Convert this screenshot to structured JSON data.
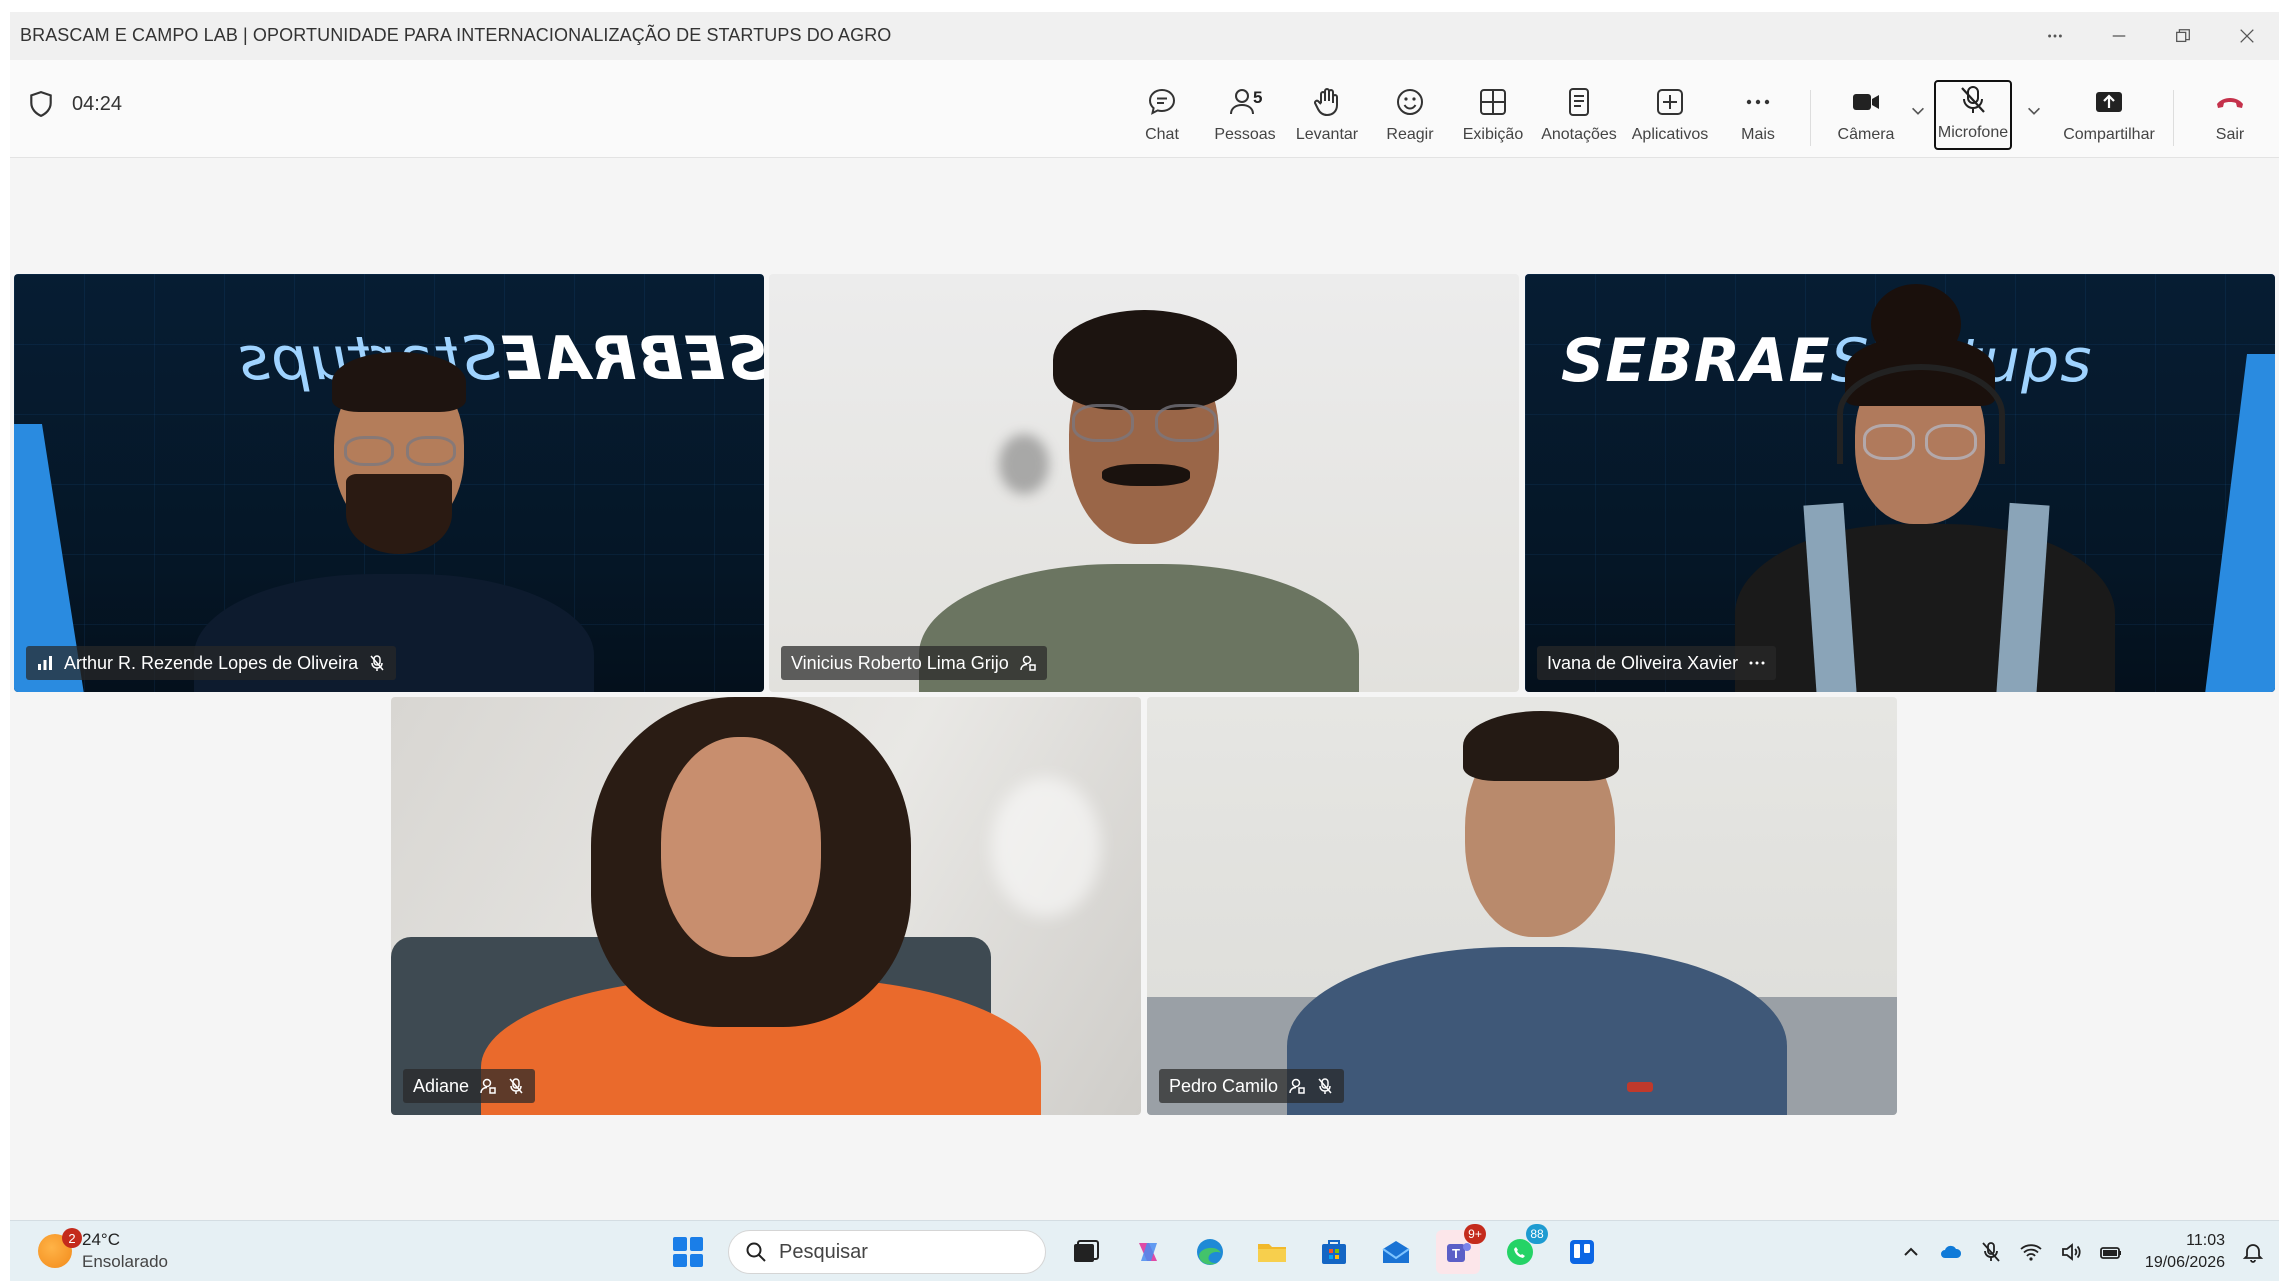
{
  "window": {
    "title": "BRASCAM E CAMPO LAB | OPORTUNIDADE PARA INTERNACIONALIZAÇÃO DE STARTUPS DO AGRO"
  },
  "meeting": {
    "timer": "04:24"
  },
  "toolbar": {
    "chat": "Chat",
    "people": "Pessoas",
    "people_count": "5",
    "raise": "Levantar",
    "react": "Reagir",
    "view": "Exibição",
    "notes": "Anotações",
    "apps": "Aplicativos",
    "more": "Mais",
    "camera": "Câmera",
    "microphone": "Microfone",
    "share": "Compartilhar",
    "leave": "Sair"
  },
  "participants": [
    {
      "name": "Arthur R. Rezende Lopes de Oliveira"
    },
    {
      "name": "Vinicius Roberto Lima Grijo"
    },
    {
      "name": "Ivana de Oliveira Xavier"
    },
    {
      "name": "Adiane"
    },
    {
      "name": "Pedro Camilo"
    }
  ],
  "backdrop": {
    "brand": "SEBRAE",
    "brand_suffix": "Startups",
    "mirrored_brand": "SEBRAE",
    "mirrored_suffix": "Startups"
  },
  "taskbar": {
    "weather_temp": "24°C",
    "weather_desc": "Ensolarado",
    "weather_badge": "2",
    "search_placeholder": "Pesquisar",
    "teams_badge": "9+",
    "whatsapp_badge": "88",
    "time": "11:03",
    "date": "19/06/2026"
  },
  "colors": {
    "highlight": "#6f6bd6",
    "leave_red": "#c4314b",
    "sebrae_blue": "#2a8be0"
  }
}
